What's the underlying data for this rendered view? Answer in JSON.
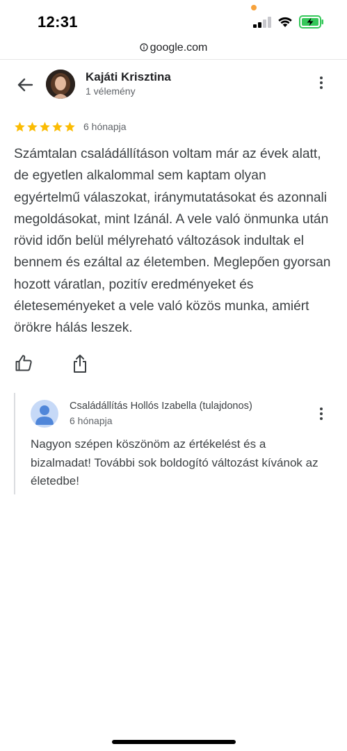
{
  "status_bar": {
    "time": "12:31",
    "battery_color": "#34c759",
    "dot_color": "#f7a23b"
  },
  "browser": {
    "url": "google.com",
    "url_icon": "info-icon"
  },
  "review": {
    "reviewer_name": "Kajáti Krisztina",
    "reviewer_sub": "1 vélemény",
    "rating": 5,
    "rating_max": 5,
    "star_color": "#fbbc04",
    "time": "6 hónapja",
    "text": "Számtalan családállításon voltam már az évek alatt, de egyetlen alkalommal sem kaptam olyan egyértelmű válaszokat, iránymutatásokat és azonnali megoldásokat, mint Izánál. A vele való önmunka után rövid időn belül mélyreható változások indultak el bennem és ezáltal az életemben. Meglepően gyorsan hozott váratlan, pozitív eredményeket és életeseményeket a vele való közös munka, amiért örökre hálás leszek."
  },
  "actions": {
    "like_icon": "thumbs-up-icon",
    "share_icon": "share-icon"
  },
  "owner_reply": {
    "name": "Családállítás Hollós Izabella (tulajdonos)",
    "time": "6 hónapja",
    "text": "Nagyon szépen köszönöm az értékelést és a bizalmadat! További sok boldogító változást kívánok az életedbe!",
    "avatar_bg": "#c6d9f7",
    "avatar_fg": "#4f86d9"
  }
}
